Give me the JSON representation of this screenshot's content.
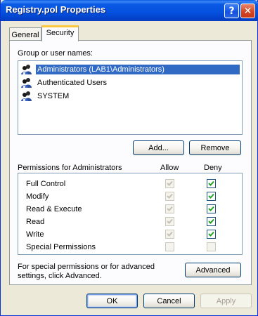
{
  "window": {
    "title": "Registry.pol Properties"
  },
  "titlebar": {
    "help_glyph": "?",
    "close_glyph": "✕"
  },
  "tabs": [
    {
      "label": "General",
      "active": false
    },
    {
      "label": "Security",
      "active": true
    }
  ],
  "security": {
    "group_label": "Group or user names:",
    "users": [
      {
        "name": "Administrators (LAB1\\Administrators)",
        "selected": true,
        "icon": "users-icon"
      },
      {
        "name": "Authenticated Users",
        "selected": false,
        "icon": "users-icon"
      },
      {
        "name": "SYSTEM",
        "selected": false,
        "icon": "users-icon"
      }
    ],
    "add_label": "Add...",
    "remove_label": "Remove",
    "permissions_header": "Permissions for Administrators",
    "allow_header": "Allow",
    "deny_header": "Deny",
    "permissions": [
      {
        "name": "Full Control",
        "allow": true,
        "deny": true
      },
      {
        "name": "Modify",
        "allow": true,
        "deny": true
      },
      {
        "name": "Read & Execute",
        "allow": true,
        "deny": true
      },
      {
        "name": "Read",
        "allow": true,
        "deny": true
      },
      {
        "name": "Write",
        "allow": true,
        "deny": true
      },
      {
        "name": "Special Permissions",
        "allow": false,
        "deny": false
      }
    ],
    "footer_text": "For special permissions or for advanced settings, click Advanced.",
    "advanced_label": "Advanced"
  },
  "dialog_buttons": {
    "ok_label": "OK",
    "cancel_label": "Cancel",
    "apply_label": "Apply"
  },
  "colors": {
    "titlebar": "#0a5ae6",
    "selection": "#316ac5",
    "check": "#21a121",
    "check_disabled": "#c5c2b2"
  }
}
